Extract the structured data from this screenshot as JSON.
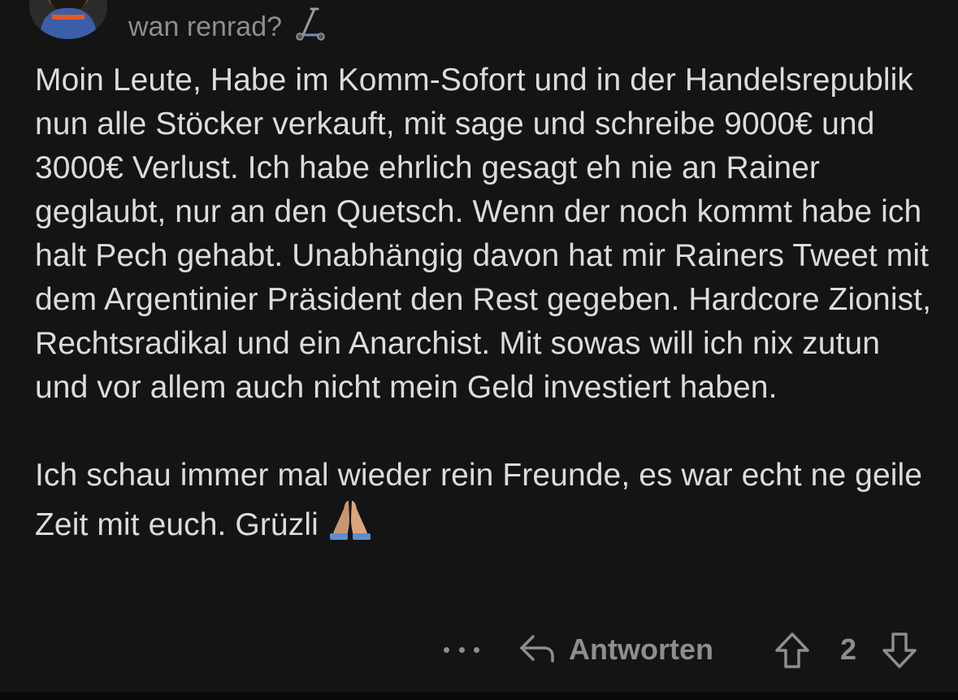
{
  "comment": {
    "author": "wan renrad?",
    "author_flair_icon": "scooter-icon",
    "paragraphs": [
      "Moin Leute, Habe im Komm-Sofort und in der Handelsrepublik nun alle Stöcker verkauft, mit sage und schreibe 9000€ und 3000€ Verlust. Ich habe ehrlich gesagt eh nie an Rainer geglaubt, nur an den Quetsch. Wenn der noch kommt habe ich halt Pech gehabt. Unabhängig davon hat mir Rainers Tweet mit dem Argentinier Präsident den Rest gegeben. Hardcore Zionist, Rechtsradikal und ein Anarchist. Mit sowas will ich nix zutun und vor allem auch nicht mein Geld investiert haben.",
      "Ich schau immer mal wieder rein Freunde, es war echt ne geile Zeit mit euch. Grüzli"
    ],
    "trailing_emoji": "folded-hands-emoji"
  },
  "actions": {
    "more_icon": "ellipsis-icon",
    "reply_icon": "reply-arrow-icon",
    "reply_label": "Antworten",
    "upvote_icon": "upvote-arrow-icon",
    "vote_count": "2",
    "downvote_icon": "downvote-arrow-icon"
  },
  "colors": {
    "background": "#141414",
    "text": "#dcdcde",
    "muted": "#8d8d92"
  }
}
